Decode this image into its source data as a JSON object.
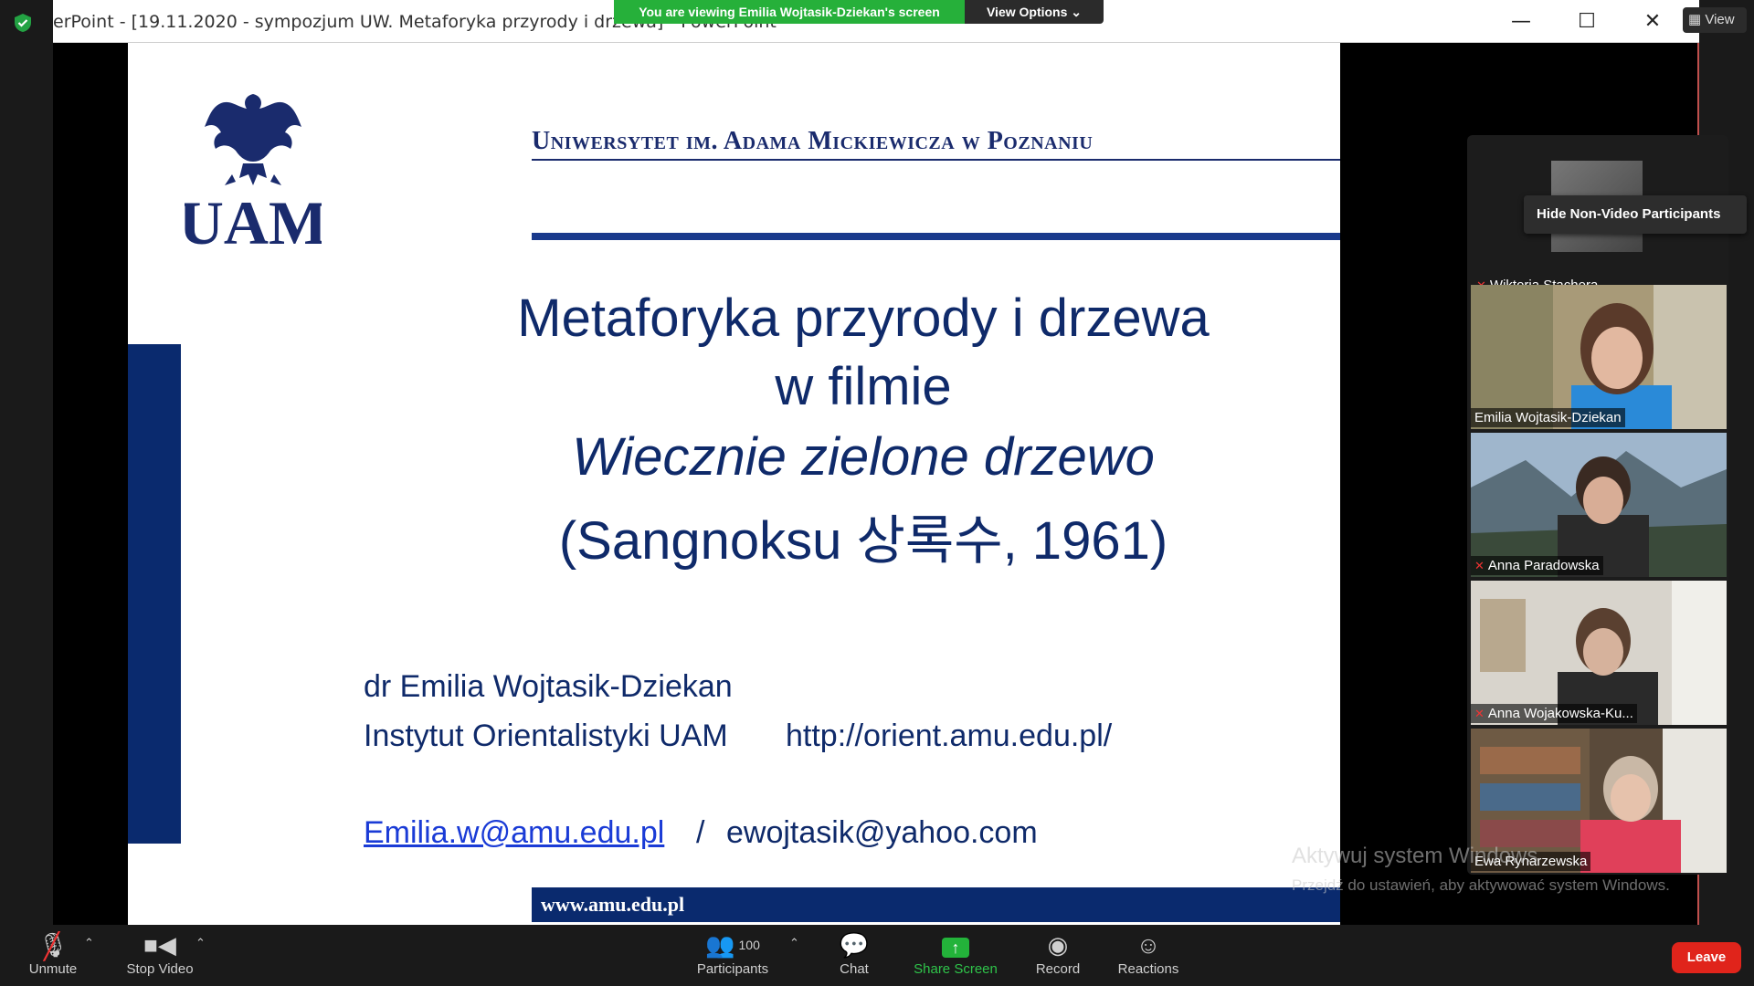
{
  "window": {
    "title": "erPoint - [19.11.2020 - sympozjum UW. Metaforyka przyrody i drzewa] - PowerPoint",
    "minimize_icon": "minimize-icon",
    "maximize_icon": "maximize-icon",
    "close_icon": "close-icon"
  },
  "banner": {
    "viewing": "You are viewing Emilia Wojtasik-Dziekan's screen",
    "view_options": "View Options ⌄",
    "view": "View"
  },
  "slide": {
    "logo_text": "UAM",
    "university": "Uniwersytet im. Adama Mickiewicza w Poznaniu",
    "title_lines": [
      "Metaforyka przyrody i drzewa",
      "w filmie",
      "Wiecznie zielone drzewo",
      "(Sangnoksu 상록수, 1961)"
    ],
    "author": "dr Emilia Wojtasik-Dziekan",
    "institute": "Instytut Orientalistyki UAM",
    "url": "http://orient.amu.edu.pl/",
    "email1": "Emilia.w@amu.edu.pl",
    "email_sep": "/",
    "email2": "ewojtasik@yahoo.com",
    "footer": "www.amu.edu.pl"
  },
  "gallery": {
    "tooltip": "Hide Non-Video Participants",
    "participants": [
      {
        "name": "Wiktoria Stachera",
        "muted": true
      },
      {
        "name": "Emilia Wojtasik-Dziekan",
        "muted": false
      },
      {
        "name": "Anna Paradowska",
        "muted": true
      },
      {
        "name": "Anna Wojakowska-Ku...",
        "muted": true
      },
      {
        "name": "Ewa Rynarzewska",
        "muted": false
      }
    ]
  },
  "watermark": {
    "line1": "Aktywuj system Windows",
    "line2": "Przejdź do ustawień, aby aktywować system Windows."
  },
  "toolbar": {
    "unmute": "Unmute",
    "stop_video": "Stop Video",
    "participants": "Participants",
    "participant_count": "100",
    "chat": "Chat",
    "share_screen": "Share Screen",
    "record": "Record",
    "reactions": "Reactions",
    "leave": "Leave"
  },
  "colors": {
    "accent_green": "#26b03a",
    "leave_red": "#e0241b",
    "slide_blue": "#0f2a6a"
  }
}
